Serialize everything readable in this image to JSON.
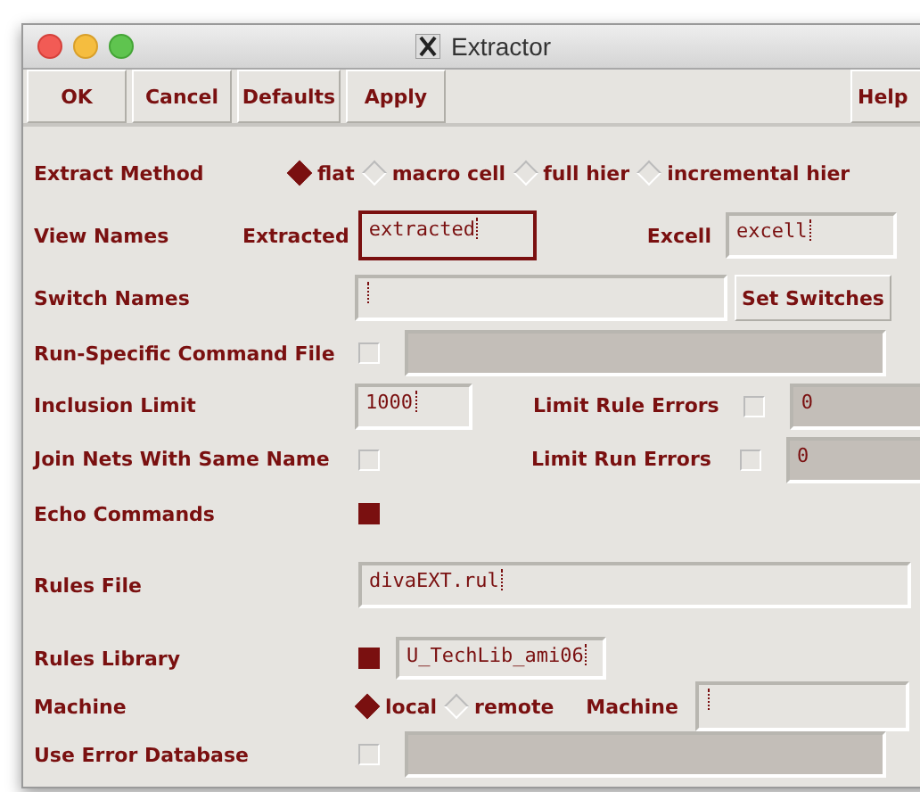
{
  "window": {
    "title": "Extractor"
  },
  "buttons": [
    {
      "label": "OK"
    },
    {
      "label": "Cancel"
    },
    {
      "label": "Defaults"
    },
    {
      "label": "Apply"
    }
  ],
  "help_button": {
    "label": "Help"
  },
  "rows": [
    {
      "kind": "radio",
      "label": "Extract Method",
      "options": [
        {
          "label": "flat",
          "selected": true
        },
        {
          "label": "macro cell",
          "selected": false
        },
        {
          "label": "full hier",
          "selected": false
        },
        {
          "label": "incremental hier",
          "selected": false
        }
      ]
    },
    {
      "kind": "views",
      "label": "View Names",
      "fields": [
        {
          "label": "Extracted",
          "value": "extracted",
          "focused": true
        },
        {
          "label": "Excell",
          "value": "excell",
          "focused": false
        }
      ]
    },
    {
      "kind": "field_button",
      "label": "Switch Names",
      "button": "Set Switches"
    },
    {
      "kind": "check_field",
      "label": "Run-Specific Command File",
      "checked": false
    },
    {
      "kind": "value_limit",
      "label": "Inclusion Limit",
      "value": "1000",
      "side": {
        "label": "Limit Rule Errors",
        "checked": false,
        "value": "0"
      }
    },
    {
      "kind": "check_limit",
      "label": "Join Nets With Same Name",
      "checked": false,
      "side": {
        "label": "Limit Run Errors",
        "checked": false,
        "value": "0"
      }
    },
    {
      "kind": "check",
      "label": "Echo Commands",
      "checked": true
    },
    {
      "kind": "field",
      "label": "Rules File",
      "value": "divaEXT.rul"
    },
    {
      "kind": "check_value",
      "label": "Rules Library",
      "checked": true,
      "value": "U_TechLib_ami06"
    },
    {
      "kind": "machine",
      "label": "Machine",
      "options": [
        {
          "label": "local",
          "selected": true
        },
        {
          "label": "remote",
          "selected": false
        }
      ],
      "field_label": "Machine"
    },
    {
      "kind": "check_field",
      "label": "Use Error Database",
      "checked": false
    }
  ]
}
